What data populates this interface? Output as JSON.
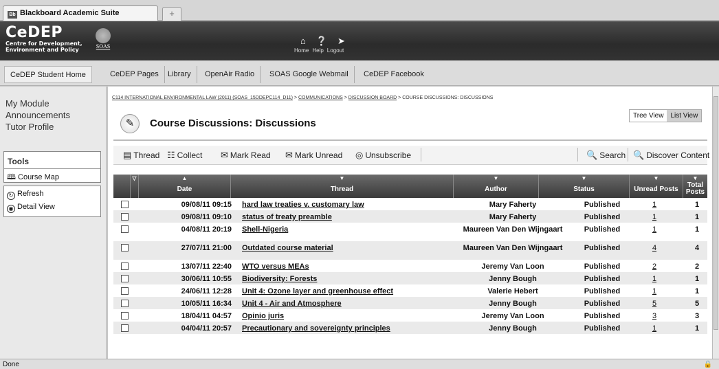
{
  "browser": {
    "tab_title": "Blackboard Academic Suite",
    "tab_favicon": "Bb",
    "new_tab_glyph": "+",
    "status": "Done"
  },
  "banner": {
    "logo": "CeDEP",
    "logo_sub_1": "Centre for Development,",
    "logo_sub_2": "Environment and Policy",
    "partner": "SOAS",
    "nav": [
      {
        "label": "Home",
        "icon": "home-icon"
      },
      {
        "label": "Help",
        "icon": "help-icon"
      },
      {
        "label": "Logout",
        "icon": "logout-icon"
      }
    ]
  },
  "navbar": {
    "items": [
      "CeDEP Student Home",
      "CeDEP Pages",
      "Library",
      "OpenAir Radio",
      "SOAS Google Webmail",
      "CeDEP Facebook"
    ]
  },
  "sidebar": {
    "links": [
      "My Module",
      "Announcements",
      "Tutor Profile"
    ],
    "tools_title": "Tools",
    "tools": [
      "Course Map"
    ],
    "actions": [
      "Refresh",
      "Detail View"
    ]
  },
  "page": {
    "breadcrumb": [
      "C114 INTERNATIONAL ENVIRONMENTAL LAW (2011) (SOAS_15DDEPC114_D11)",
      "COMMUNICATIONS",
      "DISCUSSION BOARD",
      "COURSE DISCUSSIONS: DISCUSSIONS"
    ],
    "breadcrumb_sep": ">",
    "title": "Course Discussions: Discussions",
    "views": [
      "Tree View",
      "List View"
    ]
  },
  "toolbar": {
    "thread": "Thread",
    "collect": "Collect",
    "mark_read": "Mark Read",
    "mark_unread": "Mark Unread",
    "unsubscribe": "Unsubscribe",
    "search": "Search",
    "discover": "Discover Content"
  },
  "grid": {
    "headers": {
      "date": "Date",
      "thread": "Thread",
      "author": "Author",
      "status": "Status",
      "unread": "Unread Posts",
      "total_1": "Total",
      "total_2": "Posts"
    },
    "rows": [
      {
        "date": "09/08/11 09:15",
        "thread": "hard law treaties v. customary law",
        "author": "Mary Faherty",
        "status": "Published",
        "unread": "1",
        "total": "1"
      },
      {
        "date": "09/08/11 09:10",
        "thread": "status of treaty preamble",
        "author": "Mary Faherty",
        "status": "Published",
        "unread": "1",
        "total": "1"
      },
      {
        "date": "04/08/11 20:19",
        "thread": "Shell-Nigeria",
        "author": "Maureen Van Den Wijngaart",
        "status": "Published",
        "unread": "1",
        "total": "1"
      },
      {
        "date": "27/07/11 21:00",
        "thread": "Outdated course material",
        "author": "Maureen Van Den Wijngaart",
        "status": "Published",
        "unread": "4",
        "total": "4"
      },
      {
        "date": "13/07/11 22:40",
        "thread": "WTO versus MEAs",
        "author": "Jeremy Van Loon",
        "status": "Published",
        "unread": "2",
        "total": "2"
      },
      {
        "date": "30/06/11 10:55",
        "thread": "Biodiversity: Forests",
        "author": "Jenny Bough",
        "status": "Published",
        "unread": "1",
        "total": "1"
      },
      {
        "date": "24/06/11 12:28",
        "thread": "Unit 4: Ozone layer and greenhouse effect",
        "author": "Valerie Hebert",
        "status": "Published",
        "unread": "1",
        "total": "1"
      },
      {
        "date": "10/05/11 16:34",
        "thread": "Unit 4 - Air and Atmosphere",
        "author": "Jenny Bough",
        "status": "Published",
        "unread": "5",
        "total": "5"
      },
      {
        "date": "18/04/11 04:57",
        "thread": "Opinio juris",
        "author": "Jeremy Van Loon",
        "status": "Published",
        "unread": "3",
        "total": "3"
      },
      {
        "date": "04/04/11 20:57",
        "thread": "Precautionary and sovereignty principles",
        "author": "Jenny Bough",
        "status": "Published",
        "unread": "1",
        "total": "1"
      }
    ]
  }
}
